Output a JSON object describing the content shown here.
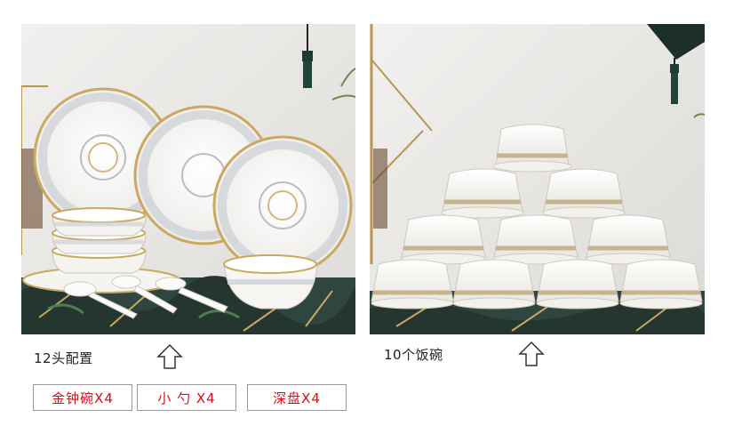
{
  "left_panel": {
    "caption": "12头配置",
    "tags": [
      "金钟碗X4",
      "小 勺 X4",
      "深盘X4"
    ]
  },
  "right_panel": {
    "caption": "10个饭碗"
  },
  "colors": {
    "tag_text": "#d0121b",
    "tag_border": "#999999",
    "caption_text": "#222222",
    "wall": "#e9e8e6",
    "tablecloth": "#2f4540",
    "gold_trim": "#c9a862"
  },
  "icons": [
    "up-arrow-icon",
    "up-arrow-icon"
  ]
}
